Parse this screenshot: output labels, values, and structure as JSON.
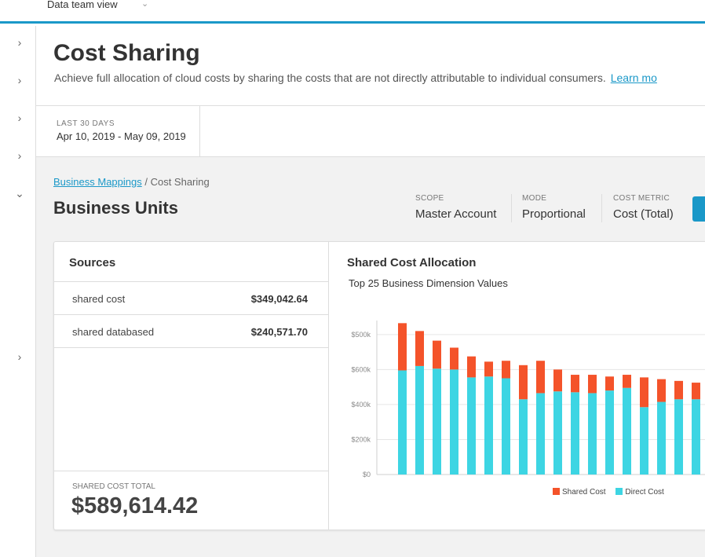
{
  "topbar": {
    "view_label": "Data team view"
  },
  "header": {
    "title": "Cost Sharing",
    "subtitle": "Achieve full allocation of cloud costs by sharing the costs that are not directly attributable to individual consumers.",
    "learn_more": "Learn mo"
  },
  "date_range": {
    "label": "LAST 30 DAYS",
    "value": "Apr 10, 2019 - May 09, 2019"
  },
  "breadcrumb": {
    "link": "Business Mappings",
    "separator": " / ",
    "current": "Cost Sharing"
  },
  "section_title": "Business Units",
  "meta": {
    "scope_label": "SCOPE",
    "scope_value": "Master Account",
    "mode_label": "MODE",
    "mode_value": "Proportional",
    "metric_label": "COST METRIC",
    "metric_value": "Cost (Total)"
  },
  "sources": {
    "title": "Sources",
    "rows": [
      {
        "name": "shared cost",
        "amount": "$349,042.64"
      },
      {
        "name": "shared databased",
        "amount": "$240,571.70"
      }
    ],
    "total_label": "SHARED COST TOTAL",
    "total_value": "$589,614.42"
  },
  "chart_title": "Shared Cost Allocation",
  "chart_subtitle": "Top 25 Business Dimension Values",
  "colors": {
    "shared": "#f4532a",
    "direct": "#3dd5e3",
    "accent": "#1a98c8"
  },
  "chart_data": {
    "type": "bar",
    "stacked": true,
    "y_tick_labels": [
      "$0",
      "$200k",
      "$400k",
      "$600k",
      "$500k"
    ],
    "y_tick_values": [
      0,
      200,
      400,
      600,
      800
    ],
    "ylim": [
      0,
      880
    ],
    "series": [
      {
        "name": "Shared Cost",
        "values": [
          270,
          200,
          160,
          125,
          120,
          85,
          100,
          195,
          185,
          125,
          100,
          105,
          80,
          75,
          170,
          130,
          105,
          95
        ]
      },
      {
        "name": "Direct Cost",
        "values": [
          595,
          620,
          605,
          600,
          555,
          560,
          550,
          430,
          465,
          475,
          470,
          465,
          480,
          495,
          385,
          415,
          430,
          430
        ]
      }
    ],
    "legend": "bottom-right"
  }
}
